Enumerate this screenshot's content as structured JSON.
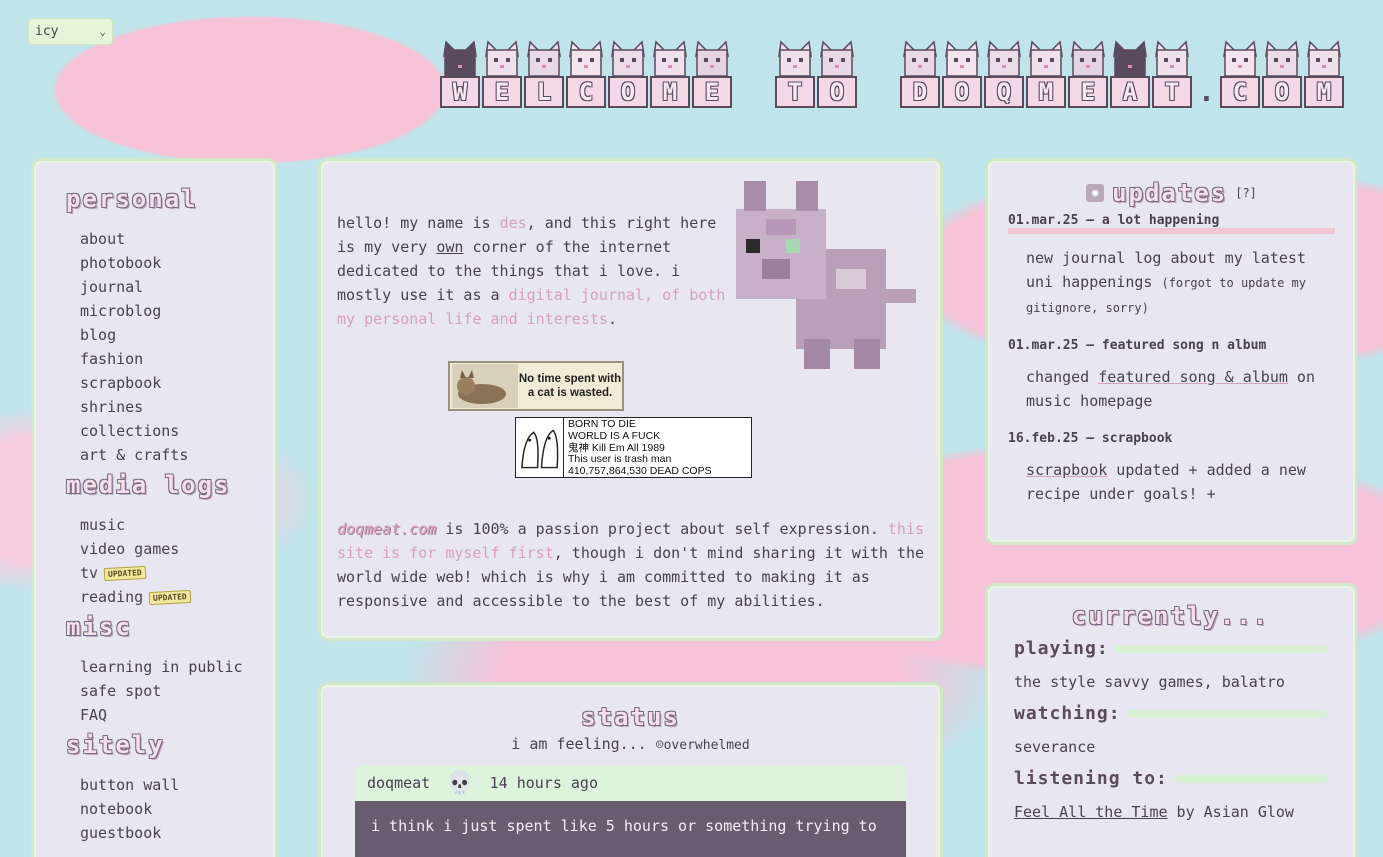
{
  "theme_select": {
    "value": "icy"
  },
  "banner": {
    "words": [
      [
        "W",
        "E",
        "L",
        "C",
        "O",
        "M",
        "E"
      ],
      [
        "T",
        "O"
      ],
      [
        "D",
        "O",
        "Q",
        "M",
        "E",
        "A",
        "T",
        ".",
        "C",
        "O",
        "M"
      ]
    ]
  },
  "sidebar": {
    "sections": [
      {
        "title": "personal",
        "items": [
          "about",
          "photobook",
          "journal",
          "microblog",
          "blog",
          "fashion",
          "scrapbook",
          "shrines",
          "collections",
          "art & crafts"
        ]
      },
      {
        "title": "media logs",
        "items": [
          "music",
          "video games",
          "tv",
          "reading"
        ],
        "badges": {
          "tv": "UPDATED",
          "reading": "UPDATED"
        }
      },
      {
        "title": "misc",
        "items": [
          "learning in public",
          "safe spot",
          "FAQ"
        ]
      },
      {
        "title": "sitely",
        "items": [
          "button wall",
          "notebook",
          "guestbook"
        ]
      }
    ]
  },
  "intro": {
    "p1_a": "hello! my name is ",
    "p1_name": "des",
    "p1_b": ", and this right here is my very ",
    "p1_own": "own",
    "p1_c": " corner of the internet dedicated to the things that i love. i mostly use it as a ",
    "p1_link": "digital journal, of both my personal life and interests",
    "p1_d": ".",
    "stamp1": "No time spent with a cat is wasted.",
    "stamp2_lines": [
      "BORN TO DIE",
      "WORLD IS A FUCK",
      "鬼神 Kill Em All 1989",
      "This user is trash man",
      "410,757,864,530 DEAD COPS"
    ],
    "p2_site": "doqmeat.com",
    "p2_a": " is 100% a passion project about self expression. ",
    "p2_link": "this site is for myself first",
    "p2_b": ", though i don't mind sharing it with the world wide web! which is why i am committed to making it as responsive and accessible to the best of my abilities."
  },
  "status": {
    "title": "status",
    "feeling_label": "i am feeling...",
    "mood": "overwhelmed",
    "user": "doqmeat",
    "time": "14 hours ago",
    "message": "i think i just spent like 5 hours or something trying to"
  },
  "updates": {
    "title": "updates",
    "help": "[?]",
    "entries": [
      {
        "date": "01.mar.25 — a lot happening",
        "text_a": "new journal log about my latest uni happenings ",
        "text_small": "(forgot to update my gitignore, sorry)"
      },
      {
        "date": "01.mar.25 — featured song n album",
        "text_pre": "changed ",
        "text_link": "featured song & album",
        "text_post": " on music homepage"
      },
      {
        "date": "16.feb.25 — scrapbook",
        "text_link": "scrapbook",
        "text_post": " updated + added a new recipe under goals! +"
      }
    ]
  },
  "currently": {
    "title": "currently...",
    "playing_label": "playing:",
    "playing": "the style savvy games, balatro",
    "watching_label": "watching:",
    "watching": "severance",
    "listening_label": "listening to:",
    "listening_song": "Feel All the Time",
    "listening_by": " by Asian Glow"
  },
  "colors": {
    "pink": "#f7c3d8",
    "sky": "#bfe4ea",
    "panel": "#e8e6f0",
    "panel_border": "#cfe9c8",
    "text": "#4a4150",
    "accent_pink": "#d8a0bc"
  }
}
